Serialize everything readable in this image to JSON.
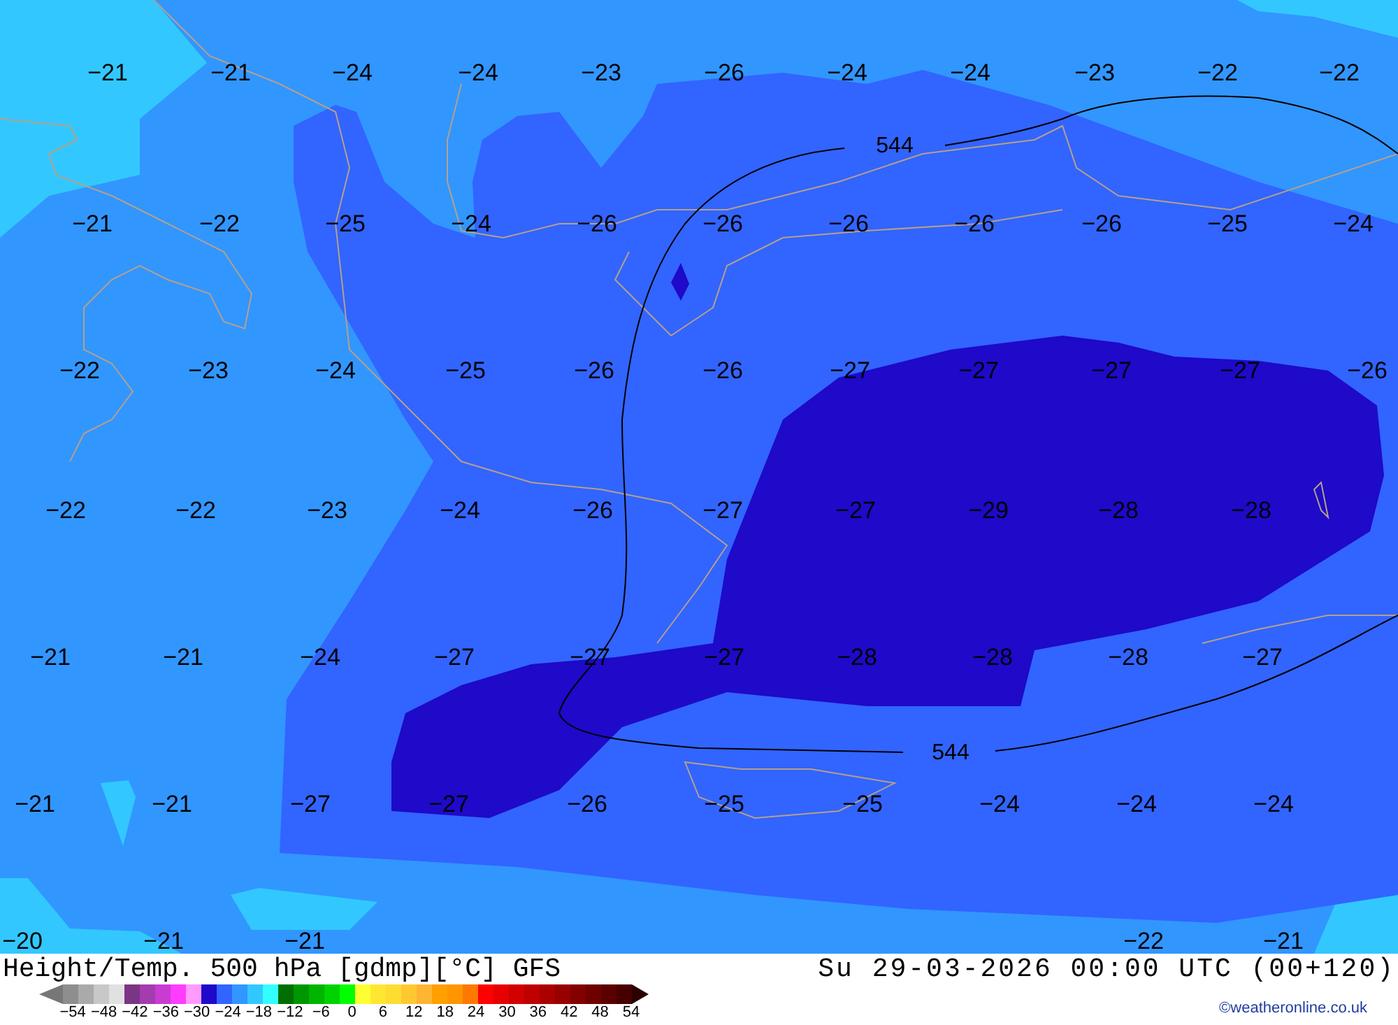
{
  "map": {
    "temperature_labels": [
      [
        "−21",
        "−21",
        "−24",
        "−24",
        "−23",
        "−26",
        "−24",
        "−24",
        "−23",
        "−22",
        "−22"
      ],
      [
        "−21",
        "−22",
        "−25",
        "−24",
        "−26",
        "−26",
        "−26",
        "−26",
        "−26",
        "−25",
        "−24"
      ],
      [
        "−22",
        "−23",
        "−24",
        "−25",
        "−26",
        "−26",
        "−27",
        "−27",
        "−27",
        "−27",
        "−26"
      ],
      [
        "−22",
        "−22",
        "−23",
        "−24",
        "−26",
        "−27",
        "−27",
        "−29",
        "−28",
        "−28"
      ],
      [
        "−21",
        "−21",
        "−24",
        "−27",
        "−27",
        "−27",
        "−28",
        "−28",
        "−28",
        "−27"
      ],
      [
        "−21",
        "−21",
        "−27",
        "−27",
        "−26",
        "−25",
        "−25",
        "−24",
        "−24",
        "−24"
      ],
      [
        "−20",
        "−21",
        "−21",
        "−22",
        "−21"
      ]
    ],
    "contour_labels": [
      "544",
      "544"
    ]
  },
  "footer": {
    "title": "Height/Temp. 500 hPa [gdmp][°C] GFS",
    "datetime": "Su 29-03-2026 00:00 UTC (00+120)",
    "credit": "©weatheronline.co.uk",
    "legend": {
      "swatches": [
        {
          "color": "#8e8e8e"
        },
        {
          "color": "#aaaaaa"
        },
        {
          "color": "#c8c8c8"
        },
        {
          "color": "#e1e1e1"
        },
        {
          "color": "#7b3585"
        },
        {
          "color": "#a43cb0"
        },
        {
          "color": "#c83cd2"
        },
        {
          "color": "#ff3cff"
        },
        {
          "color": "#ff9bff"
        },
        {
          "color": "#1e0ac8"
        },
        {
          "color": "#3264ff"
        },
        {
          "color": "#3296ff"
        },
        {
          "color": "#32c8ff"
        },
        {
          "color": "#32ffff"
        },
        {
          "color": "#006e00"
        },
        {
          "color": "#009600"
        },
        {
          "color": "#00b400"
        },
        {
          "color": "#00d200"
        },
        {
          "color": "#00ff00"
        },
        {
          "color": "#ffff32"
        },
        {
          "color": "#ffe632"
        },
        {
          "color": "#ffdc32"
        },
        {
          "color": "#ffc832"
        },
        {
          "color": "#ffb432"
        },
        {
          "color": "#ffa000"
        },
        {
          "color": "#ff9600"
        },
        {
          "color": "#ff7800"
        },
        {
          "color": "#ff0000"
        },
        {
          "color": "#e60000"
        },
        {
          "color": "#d20000"
        },
        {
          "color": "#be0000"
        },
        {
          "color": "#aa0000"
        },
        {
          "color": "#960000"
        },
        {
          "color": "#820000"
        },
        {
          "color": "#6e0000"
        },
        {
          "color": "#5a0000"
        },
        {
          "color": "#460000"
        }
      ],
      "ticks": [
        "−54",
        "−48",
        "−42",
        "−36",
        "−30",
        "−24",
        "−18",
        "−12",
        "−6",
        "0",
        "6",
        "12",
        "18",
        "24",
        "30",
        "36",
        "42",
        "48",
        "54"
      ]
    }
  }
}
